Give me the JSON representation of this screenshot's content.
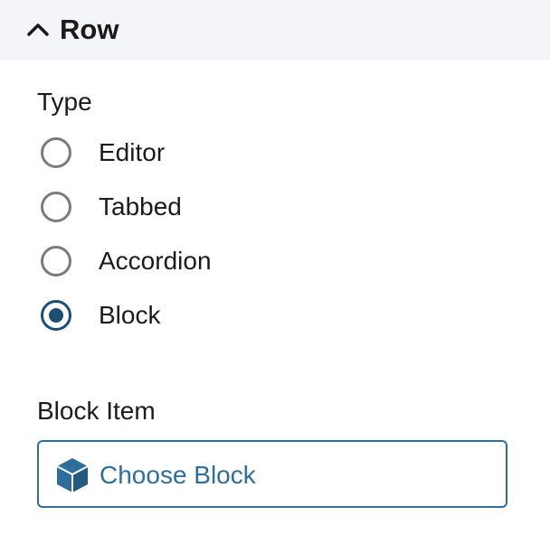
{
  "panel": {
    "title": "Row",
    "expanded": true
  },
  "type_field": {
    "label": "Type",
    "options": [
      {
        "label": "Editor",
        "checked": false
      },
      {
        "label": "Tabbed",
        "checked": false
      },
      {
        "label": "Accordion",
        "checked": false
      },
      {
        "label": "Block",
        "checked": true
      }
    ]
  },
  "block_item_field": {
    "label": "Block Item",
    "button_label": "Choose Block",
    "icon": "cube-icon"
  },
  "colors": {
    "accent": "#2f6e9a",
    "radio_checked": "#1e4f72",
    "radio_unchecked": "#7b7b7b",
    "header_bg": "#f3f5f8"
  }
}
